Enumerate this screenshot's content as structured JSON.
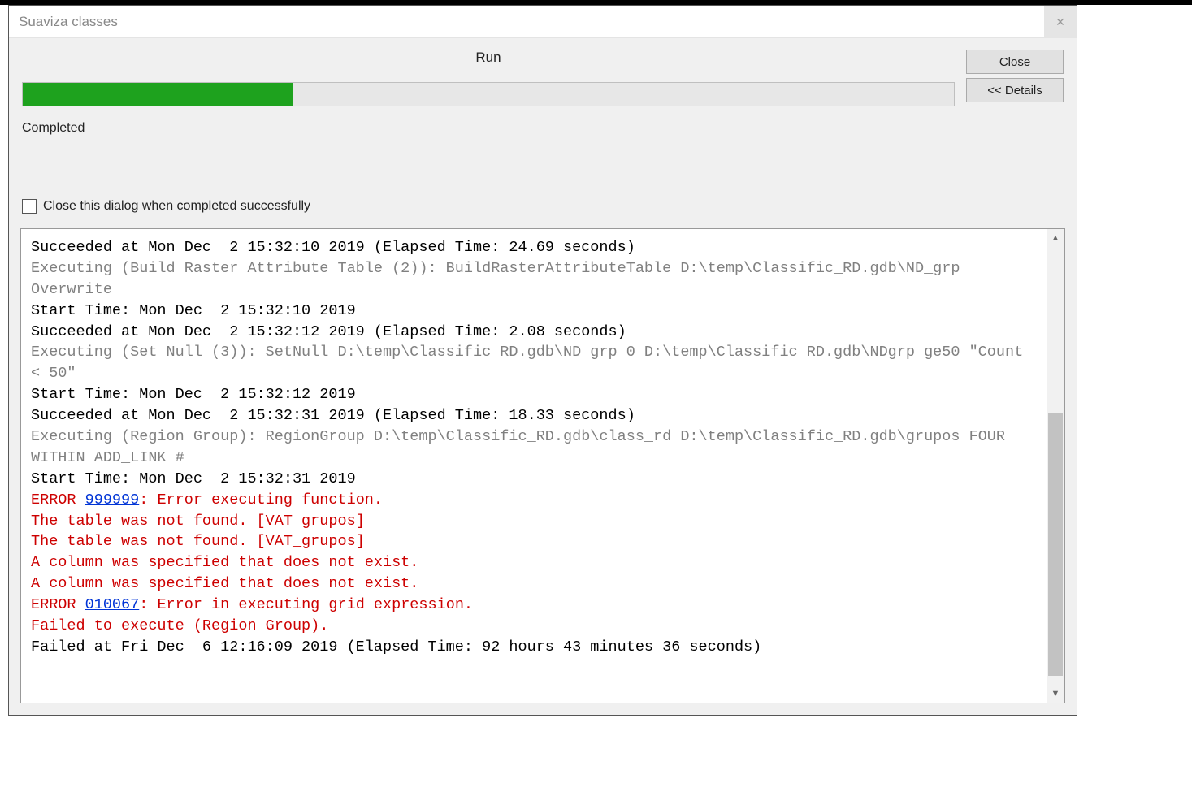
{
  "titlebar": {
    "title": "Suaviza classes"
  },
  "header": {
    "run_label": "Run",
    "close_btn": "Close",
    "details_btn": "<< Details",
    "status": "Completed",
    "checkbox_label": "Close this dialog when completed successfully",
    "progress_percent": 29
  },
  "log": {
    "lines": [
      {
        "text": "Succeeded at Mon Dec  2 15:32:10 2019 (Elapsed Time: 24.69 seconds)",
        "cls": ""
      },
      {
        "text": "Executing (Build Raster Attribute Table (2)): BuildRasterAttributeTable D:\\temp\\Classific_RD.gdb\\ND_grp Overwrite",
        "cls": "log-gray"
      },
      {
        "text": "Start Time: Mon Dec  2 15:32:10 2019",
        "cls": ""
      },
      {
        "text": "Succeeded at Mon Dec  2 15:32:12 2019 (Elapsed Time: 2.08 seconds)",
        "cls": ""
      },
      {
        "text": "Executing (Set Null (3)): SetNull D:\\temp\\Classific_RD.gdb\\ND_grp 0 D:\\temp\\Classific_RD.gdb\\NDgrp_ge50 \"Count < 50\"",
        "cls": "log-gray"
      },
      {
        "text": "Start Time: Mon Dec  2 15:32:12 2019",
        "cls": ""
      },
      {
        "text": "Succeeded at Mon Dec  2 15:32:31 2019 (Elapsed Time: 18.33 seconds)",
        "cls": ""
      },
      {
        "text": "Executing (Region Group): RegionGroup D:\\temp\\Classific_RD.gdb\\class_rd D:\\temp\\Classific_RD.gdb\\grupos FOUR WITHIN ADD_LINK #",
        "cls": "log-gray"
      },
      {
        "text": "Start Time: Mon Dec  2 15:32:31 2019",
        "cls": ""
      },
      {
        "prefix": "ERROR ",
        "link": "999999",
        "suffix": ": Error executing function.",
        "cls": "log-error",
        "hasLink": true
      },
      {
        "text": "The table was not found. [VAT_grupos]",
        "cls": "log-error"
      },
      {
        "text": "The table was not found. [VAT_grupos]",
        "cls": "log-error"
      },
      {
        "text": "A column was specified that does not exist.",
        "cls": "log-error"
      },
      {
        "text": "A column was specified that does not exist.",
        "cls": "log-error"
      },
      {
        "prefix": "ERROR ",
        "link": "010067",
        "suffix": ": Error in executing grid expression.",
        "cls": "log-error",
        "hasLink": true
      },
      {
        "text": "Failed to execute (Region Group).",
        "cls": "log-error"
      },
      {
        "text": "Failed at Fri Dec  6 12:16:09 2019 (Elapsed Time: 92 hours 43 minutes 36 seconds)",
        "cls": ""
      }
    ]
  }
}
